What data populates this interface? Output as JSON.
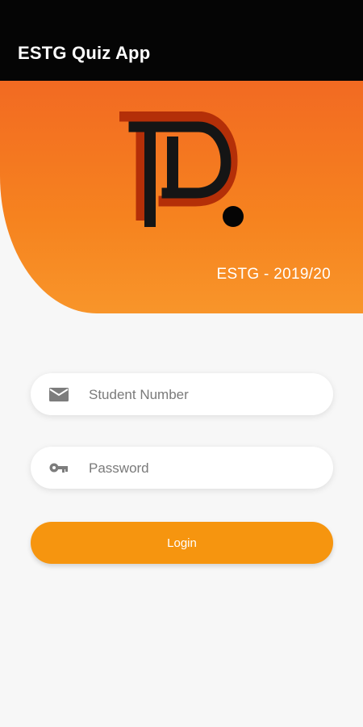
{
  "app_bar": {
    "title": "ESTG Quiz App",
    "background": "#050505"
  },
  "hero": {
    "logo_icon": "p-dot-logo",
    "year_text": "ESTG - 2019/20",
    "gradient_start": "#f26a22",
    "gradient_end": "#f8952a"
  },
  "form": {
    "student_number": {
      "icon": "mail-icon",
      "placeholder": "Student Number",
      "value": ""
    },
    "password": {
      "icon": "key-icon",
      "placeholder": "Password",
      "value": ""
    },
    "login_label": "Login",
    "button_color": "#f6950f"
  }
}
